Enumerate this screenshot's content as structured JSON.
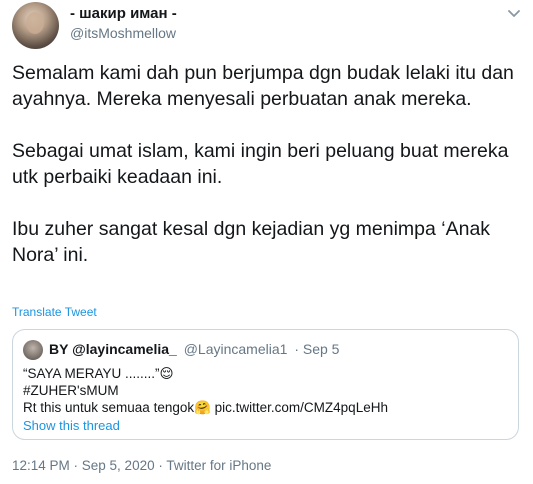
{
  "author": {
    "display_name": "- шакир иман -",
    "handle": "@itsMoshmellow"
  },
  "tweet": {
    "paragraphs": [
      "Semalam kami dah pun berjumpa dgn budak lelaki itu dan ayahnya. Mereka menyesali perbuatan anak mereka.",
      "Sebagai umat islam, kami ingin beri peluang buat mereka utk perbaiki keadaan ini.",
      "Ibu zuher sangat kesal dgn kejadian yg menimpa ‘Anak Nora’ ini."
    ],
    "translate_label": "Translate Tweet"
  },
  "quote": {
    "display_name": "BY @layincamelia_",
    "handle": "@Layincamelia1",
    "date": "· Sep 5",
    "lines": [
      "“SAYA MERAYU ........”😌",
      "#ZUHER'sMUM",
      "Rt this untuk semuaa tengok🤗 pic.twitter.com/CMZ4pqLeHh"
    ],
    "show_thread_label": "Show this thread"
  },
  "meta": {
    "timestamp": "12:14 PM · Sep 5, 2020 · Twitter for iPhone"
  },
  "icons": {
    "more": "chevron-down-icon"
  },
  "colors": {
    "link": "#1b95e0",
    "secondary_text": "#657786",
    "border": "#ccd6dd"
  }
}
